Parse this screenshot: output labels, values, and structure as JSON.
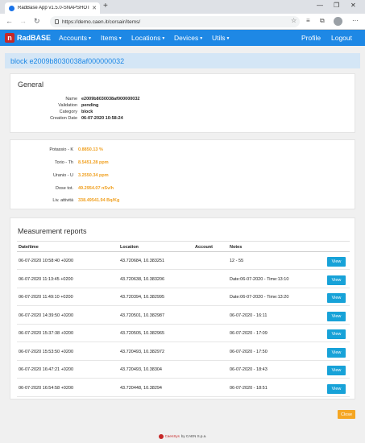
{
  "browser": {
    "tab_title": "RadBase App v1.5.0-SNAPSHOT",
    "url": "https://demo.caen.it/corsair/items/"
  },
  "navbar": {
    "brand": "RadBASE",
    "menu": [
      "Accounts",
      "Items",
      "Locations",
      "Devices",
      "Utils"
    ],
    "profile": "Profile",
    "logout": "Logout"
  },
  "page_title": "block e2009b8030038af000000032",
  "general": {
    "title": "General",
    "fields": [
      {
        "label": "Name",
        "value": "e2009b8030038af000000032"
      },
      {
        "label": "Validation",
        "value": "pending"
      },
      {
        "label": "Category",
        "value": "block"
      },
      {
        "label": "Creation Date",
        "value": "06-07-2020 10:58:24"
      }
    ]
  },
  "measurements": [
    {
      "label": "Potassio - K",
      "value": "0.8850.13 %"
    },
    {
      "label": "Torio - Th",
      "value": "8.5451.28 ppm"
    },
    {
      "label": "Uranio - U",
      "value": "3.2550.34 ppm"
    },
    {
      "label": "Dose tot.",
      "value": "49.2954.07 nSv/h"
    },
    {
      "label": "Liv. attività",
      "value": "338.49541.94 Bq/Kg"
    }
  ],
  "reports": {
    "title": "Measurement reports",
    "columns": [
      "Date/time",
      "Location",
      "Account",
      "Notes"
    ],
    "view_label": "View",
    "rows": [
      {
        "date": "06-07-2020 10:58:40 +0200",
        "location": "43.720684, 10.383251",
        "account": "",
        "notes": "12 - 55"
      },
      {
        "date": "06-07-2020 11:13:45 +0200",
        "location": "43.720638, 10.383206",
        "account": "",
        "notes": "Date:06-07-2020 - Time:13:10"
      },
      {
        "date": "06-07-2020 11:49:10 +0200",
        "location": "43.720394, 10.382995",
        "account": "",
        "notes": "Date:06-07-2020 - Time:13:20"
      },
      {
        "date": "06-07-2020 14:39:50 +0200",
        "location": "43.720501, 10.382987",
        "account": "",
        "notes": "06-07-2020 - 16:11"
      },
      {
        "date": "06-07-2020 15:37:38 +0200",
        "location": "43.720505, 10.382965",
        "account": "",
        "notes": "06-07-2020 - 17:09"
      },
      {
        "date": "06-07-2020 15:53:50 +0200",
        "location": "43.720493, 10.382972",
        "account": "",
        "notes": "06-07-2020 - 17:50"
      },
      {
        "date": "06-07-2020 16:47:21 +0200",
        "location": "43.720493, 10.38304",
        "account": "",
        "notes": "06-07-2020 - 18:43"
      },
      {
        "date": "06-07-2020 16:54:58 +0200",
        "location": "43.720448, 10.38294",
        "account": "",
        "notes": "06-07-2020 - 18:51"
      }
    ]
  },
  "close_label": "Close",
  "footer": {
    "brand": "CaenSys",
    "text": "by CAEN S.p.a."
  }
}
